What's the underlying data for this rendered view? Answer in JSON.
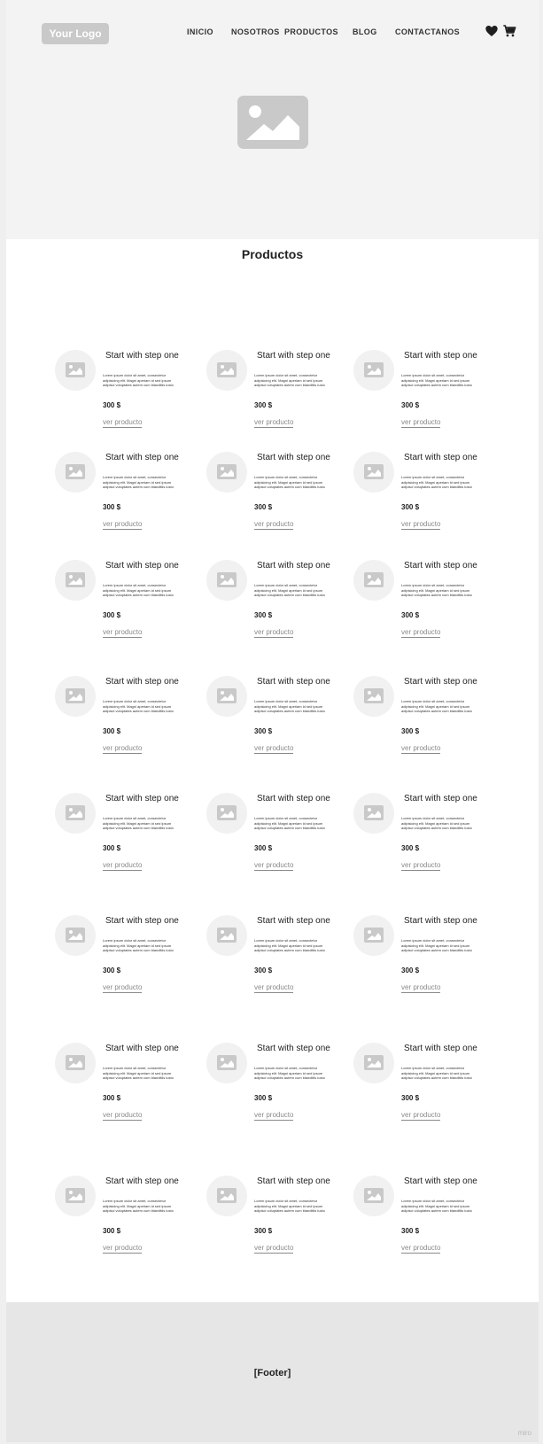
{
  "header": {
    "logo": "Your Logo",
    "nav": [
      "INICIO",
      "NOSOTROS",
      "PRODUCTOS",
      "BLOG",
      "CONTACTANOS"
    ],
    "icons": [
      "heart-icon",
      "cart-icon"
    ]
  },
  "hero": {
    "image_icon": "image-placeholder-icon"
  },
  "products": {
    "title": "Productos",
    "cards": [
      {
        "title": "Start with step one",
        "desc": "Lorem ipsum dolor sit amet, consectetur adipisicing elit. Magni aperiam id sed ipsum adipisci voluptates autem cum blanditiis iusto",
        "price": "300 $",
        "link": "ver producto"
      },
      {
        "title": "Start with step one",
        "desc": "Lorem ipsum dolor sit amet, consectetur adipisicing elit. Magni aperiam id sed ipsum adipisci voluptates autem cum blanditiis iusto",
        "price": "300 $",
        "link": "ver producto"
      },
      {
        "title": "Start with step one",
        "desc": "Lorem ipsum dolor sit amet, consectetur adipisicing elit. Magni aperiam id sed ipsum adipisci voluptates autem cum blanditiis iusto",
        "price": "300 $",
        "link": "ver producto"
      },
      {
        "title": "Start with step one",
        "desc": "Lorem ipsum dolor sit amet, consectetur adipisicing elit. Magni aperiam id sed ipsum adipisci voluptates autem cum blanditiis iusto",
        "price": "300 $",
        "link": "ver producto"
      },
      {
        "title": "Start with step one",
        "desc": "Lorem ipsum dolor sit amet, consectetur adipisicing elit. Magni aperiam id sed ipsum adipisci voluptates autem cum blanditiis iusto",
        "price": "300 $",
        "link": "ver producto"
      },
      {
        "title": "Start with step one",
        "desc": "Lorem ipsum dolor sit amet, consectetur adipisicing elit. Magni aperiam id sed ipsum adipisci voluptates autem cum blanditiis iusto",
        "price": "300 $",
        "link": "ver producto"
      },
      {
        "title": "Start with step one",
        "desc": "Lorem ipsum dolor sit amet, consectetur adipisicing elit. Magni aperiam id sed ipsum adipisci voluptates autem cum blanditiis iusto",
        "price": "300 $",
        "link": "ver producto"
      },
      {
        "title": "Start with step one",
        "desc": "Lorem ipsum dolor sit amet, consectetur adipisicing elit. Magni aperiam id sed ipsum adipisci voluptates autem cum blanditiis iusto",
        "price": "300 $",
        "link": "ver producto"
      },
      {
        "title": "Start with step one",
        "desc": "Lorem ipsum dolor sit amet, consectetur adipisicing elit. Magni aperiam id sed ipsum adipisci voluptates autem cum blanditiis iusto",
        "price": "300 $",
        "link": "ver producto"
      },
      {
        "title": "Start with step one",
        "desc": "Lorem ipsum dolor sit amet, consectetur adipisicing elit. Magni aperiam id sed ipsum adipisci voluptates autem cum blanditiis iusto",
        "price": "300 $",
        "link": "ver producto"
      },
      {
        "title": "Start with step one",
        "desc": "Lorem ipsum dolor sit amet, consectetur adipisicing elit. Magni aperiam id sed ipsum adipisci voluptates autem cum blanditiis iusto",
        "price": "300 $",
        "link": "ver producto"
      },
      {
        "title": "Start with step one",
        "desc": "Lorem ipsum dolor sit amet, consectetur adipisicing elit. Magni aperiam id sed ipsum adipisci voluptates autem cum blanditiis iusto",
        "price": "300 $",
        "link": "ver producto"
      },
      {
        "title": "Start with step one",
        "desc": "Lorem ipsum dolor sit amet, consectetur adipisicing elit. Magni aperiam id sed ipsum adipisci voluptates autem cum blanditiis iusto",
        "price": "300 $",
        "link": "ver producto"
      },
      {
        "title": "Start with step one",
        "desc": "Lorem ipsum dolor sit amet, consectetur adipisicing elit. Magni aperiam id sed ipsum adipisci voluptates autem cum blanditiis iusto",
        "price": "300 $",
        "link": "ver producto"
      },
      {
        "title": "Start with step one",
        "desc": "Lorem ipsum dolor sit amet, consectetur adipisicing elit. Magni aperiam id sed ipsum adipisci voluptates autem cum blanditiis iusto",
        "price": "300 $",
        "link": "ver producto"
      },
      {
        "title": "Start with step one",
        "desc": "Lorem ipsum dolor sit amet, consectetur adipisicing elit. Magni aperiam id sed ipsum adipisci voluptates autem cum blanditiis iusto",
        "price": "300 $",
        "link": "ver producto"
      },
      {
        "title": "Start with step one",
        "desc": "Lorem ipsum dolor sit amet, consectetur adipisicing elit. Magni aperiam id sed ipsum adipisci voluptates autem cum blanditiis iusto",
        "price": "300 $",
        "link": "ver producto"
      },
      {
        "title": "Start with step one",
        "desc": "Lorem ipsum dolor sit amet, consectetur adipisicing elit. Magni aperiam id sed ipsum adipisci voluptates autem cum blanditiis iusto",
        "price": "300 $",
        "link": "ver producto"
      },
      {
        "title": "Start with step one",
        "desc": "Lorem ipsum dolor sit amet, consectetur adipisicing elit. Magni aperiam id sed ipsum adipisci voluptates autem cum blanditiis iusto",
        "price": "300 $",
        "link": "ver producto"
      },
      {
        "title": "Start with step one",
        "desc": "Lorem ipsum dolor sit amet, consectetur adipisicing elit. Magni aperiam id sed ipsum adipisci voluptates autem cum blanditiis iusto",
        "price": "300 $",
        "link": "ver producto"
      },
      {
        "title": "Start with step one",
        "desc": "Lorem ipsum dolor sit amet, consectetur adipisicing elit. Magni aperiam id sed ipsum adipisci voluptates autem cum blanditiis iusto",
        "price": "300 $",
        "link": "ver producto"
      },
      {
        "title": "Start with step one",
        "desc": "Lorem ipsum dolor sit amet, consectetur adipisicing elit. Magni aperiam id sed ipsum adipisci voluptates autem cum blanditiis iusto",
        "price": "300 $",
        "link": "ver producto"
      },
      {
        "title": "Start with step one",
        "desc": "Lorem ipsum dolor sit amet, consectetur adipisicing elit. Magni aperiam id sed ipsum adipisci voluptates autem cum blanditiis iusto",
        "price": "300 $",
        "link": "ver producto"
      },
      {
        "title": "Start with step one",
        "desc": "Lorem ipsum dolor sit amet, consectetur adipisicing elit. Magni aperiam id sed ipsum adipisci voluptates autem cum blanditiis iusto",
        "price": "300 $",
        "link": "ver producto"
      }
    ]
  },
  "footer": {
    "label": "[Footer]"
  },
  "watermark": "miro",
  "colors": {
    "placeholder": "#c9c9c9",
    "hero_bg": "#f3f3f3",
    "footer_bg": "#e6e6e6",
    "link": "#8a8a8a"
  }
}
